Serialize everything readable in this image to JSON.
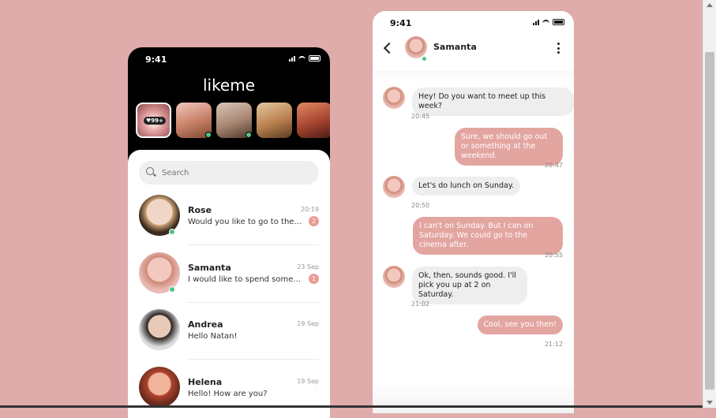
{
  "colors": {
    "background": "#dfabab",
    "accent": "#e3a5a0",
    "online": "#4ec48a"
  },
  "phone_list": {
    "status_time": "9:41",
    "app_title": "likeme",
    "likes_badge": "♥99+",
    "search_placeholder": "Search",
    "chats": [
      {
        "name": "Rose",
        "message": "Would you like to go to the...",
        "time": "20:19",
        "unread": "2"
      },
      {
        "name": "Samanta",
        "message": "I would like to spend some...",
        "time": "23 Sep",
        "unread": "1"
      },
      {
        "name": "Andrea",
        "message": "Hello Natan!",
        "time": "19 Sep",
        "unread": ""
      },
      {
        "name": "Helena",
        "message": "Hello! How are you?",
        "time": "19 Sep",
        "unread": ""
      }
    ]
  },
  "phone_chat": {
    "status_time": "9:41",
    "contact_name": "Samanta",
    "messages": [
      {
        "direction": "in",
        "text": "Hey! Do you want to meet up this week?",
        "time": "20:45"
      },
      {
        "direction": "out",
        "text": "Sure, we should go out or something at the weekend.",
        "time": "20:47"
      },
      {
        "direction": "in",
        "text": "Let's do lunch on Sunday.",
        "time": "20:50"
      },
      {
        "direction": "out",
        "text": "I can't on Sunday. But I can on Saturday. We could go to the cinema after.",
        "time": "20:55"
      },
      {
        "direction": "in",
        "text": "Ok, then, sounds good. I'll pick you up at 2 on Saturday.",
        "time": "21:02"
      },
      {
        "direction": "out",
        "text": "Cool, see you then!",
        "time": "21:12"
      }
    ]
  }
}
